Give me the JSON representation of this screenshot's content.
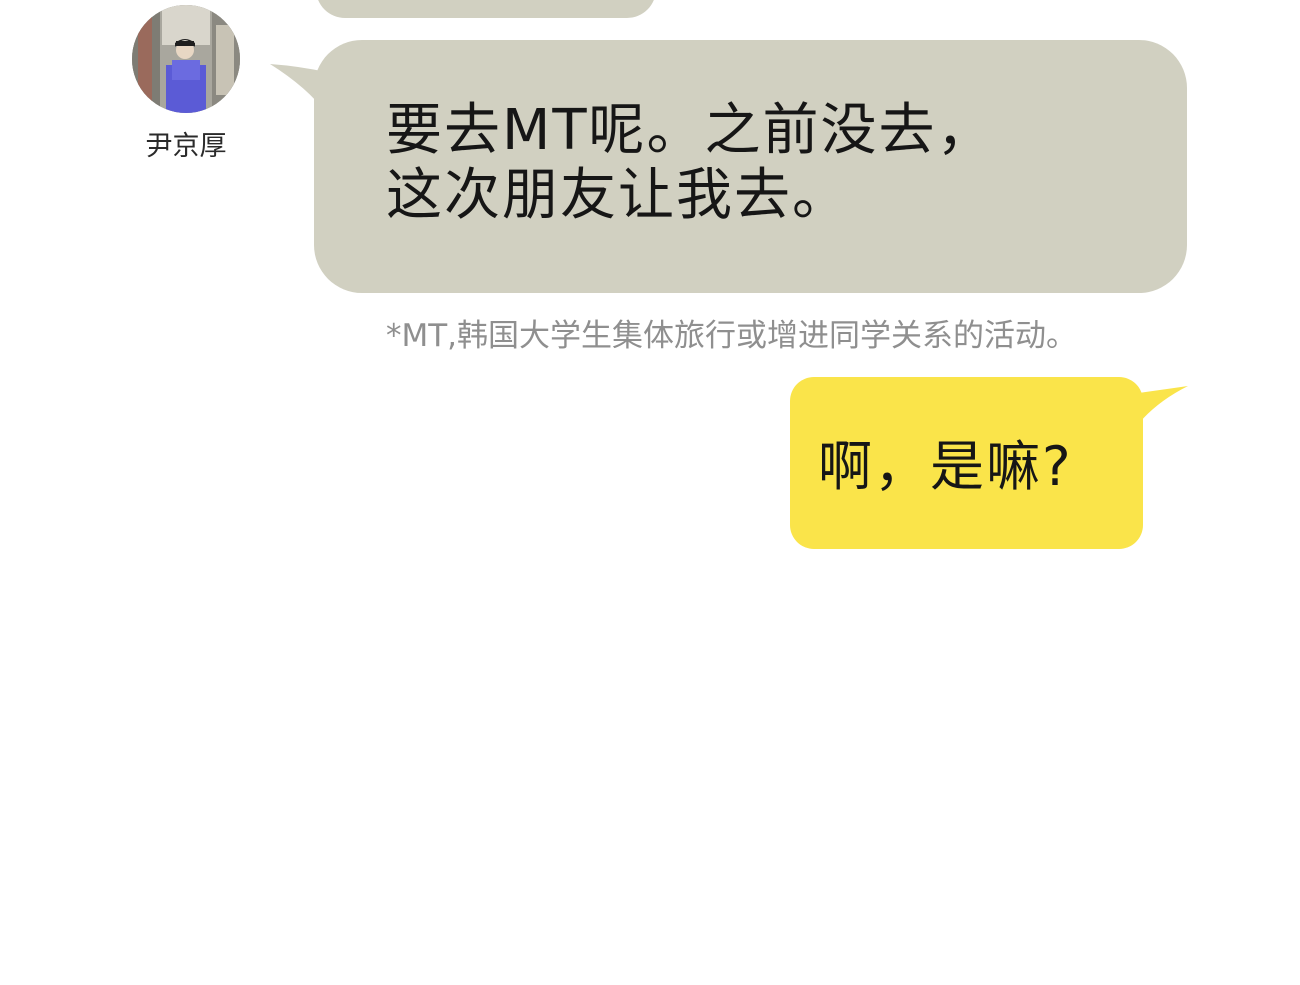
{
  "conversation": {
    "sender": {
      "name": "尹京厚",
      "avatar_icon": "user-avatar-icon"
    },
    "messages": [
      {
        "side": "left",
        "bubble_color": "#d1d0c1",
        "lines": [
          "要去MT呢。之前没去，",
          "这次朋友让我去。"
        ]
      },
      {
        "side": "right",
        "bubble_color": "#fae44a",
        "lines": [
          "啊，是嘛?"
        ]
      }
    ],
    "footnote": "*MT,韩国大学生集体旅行或增进同学关系的活动。"
  },
  "colors": {
    "background": "#ffffff",
    "incoming_bubble": "#d1d0c1",
    "outgoing_bubble": "#fae44a",
    "footnote_text": "#8f8f8f"
  }
}
